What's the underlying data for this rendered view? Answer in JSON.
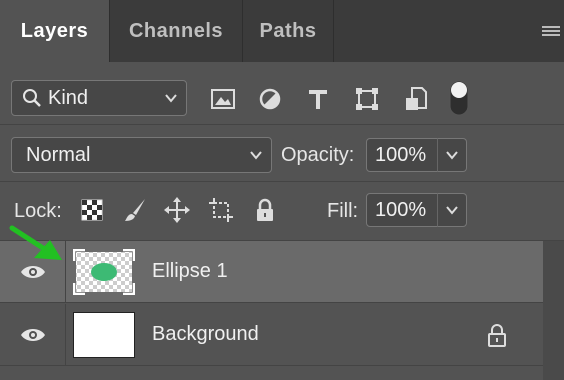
{
  "tabs": [
    {
      "label": "Layers",
      "active": true
    },
    {
      "label": "Channels",
      "active": false
    },
    {
      "label": "Paths",
      "active": false
    }
  ],
  "filter": {
    "kind_label": "Kind",
    "filter_icons": [
      "image-filter-icon",
      "adjustment-filter-icon",
      "type-filter-icon",
      "shape-filter-icon",
      "smart-object-filter-icon",
      "filter-toggle-icon"
    ]
  },
  "blend": {
    "mode": "Normal",
    "opacity_label": "Opacity:",
    "opacity_value": "100%"
  },
  "lock": {
    "label": "Lock:",
    "icons": [
      "lock-transparent-pixels-icon",
      "lock-image-pixels-icon",
      "lock-position-icon",
      "lock-artboard-icon",
      "lock-all-icon"
    ],
    "fill_label": "Fill:",
    "fill_value": "100%"
  },
  "layers": [
    {
      "name": "Ellipse 1",
      "selected": true,
      "visible": true,
      "locked": false
    },
    {
      "name": "Background",
      "selected": false,
      "visible": true,
      "locked": true
    }
  ],
  "colors": {
    "panel_bg": "#535353",
    "tabbar_bg": "#3b3b3b",
    "selected_layer_bg": "#6a6a6a",
    "ellipse_fill": "#3dba74",
    "annotation_arrow": "#22c022"
  }
}
